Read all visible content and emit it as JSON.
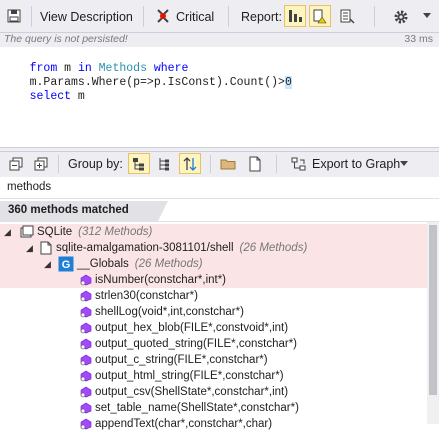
{
  "toolbar": {
    "view_description": "View Description",
    "critical": "Critical",
    "report": "Report:"
  },
  "status": {
    "message": "The query is not persisted!",
    "time": "33 ms"
  },
  "query": {
    "line1": [
      "from",
      " m ",
      "in",
      " ",
      "Methods",
      " ",
      "where"
    ],
    "line2_a": "m.Params.Where(p=>p.IsConst).Count()>",
    "line2_b": "0",
    "line3": [
      "select",
      " m"
    ]
  },
  "bottom_toolbar": {
    "group_by": "Group by:",
    "export": "Export to Graph"
  },
  "search": {
    "value": "methods"
  },
  "results": {
    "matched": "360 methods matched",
    "tree": {
      "root": {
        "label": "SQLite",
        "count": "(312 Methods)"
      },
      "file": {
        "label": "sqlite-amalgamation-3081101/shell",
        "count": "(26 Methods)"
      },
      "ns": {
        "label": "__Globals",
        "count": "(26 Methods)"
      },
      "methods": [
        "isNumber(constchar*,int*)",
        "strlen30(constchar*)",
        "shellLog(void*,int,constchar*)",
        "output_hex_blob(FILE*,constvoid*,int)",
        "output_quoted_string(FILE*,constchar*)",
        "output_c_string(FILE*,constchar*)",
        "output_html_string(FILE*,constchar*)",
        "output_csv(ShellState*,constchar*,int)",
        "set_table_name(ShellState*,constchar*)",
        "appendText(char*,constchar*,char)"
      ]
    }
  }
}
